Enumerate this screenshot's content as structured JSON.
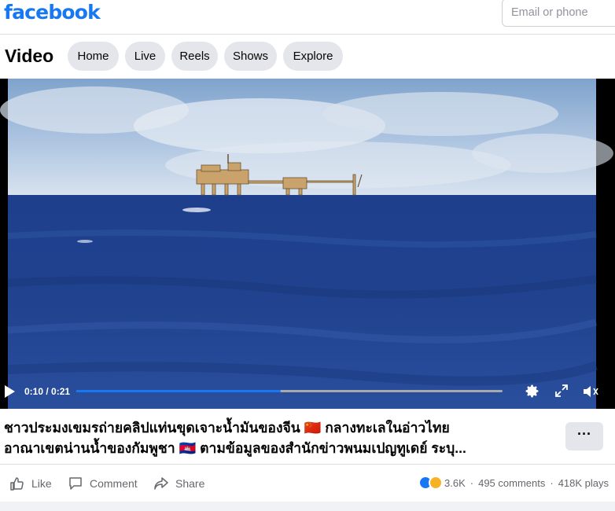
{
  "header": {
    "logo": "facebook",
    "email_placeholder": "Email or phone"
  },
  "nav": {
    "title": "Video",
    "pills": [
      "Home",
      "Live",
      "Reels",
      "Shows",
      "Explore"
    ]
  },
  "player": {
    "time": "0:10 / 0:21",
    "progress": 0.48
  },
  "post": {
    "caption_line1": "ชาวประมงเขมรถ่ายคลิปแท่นขุดเจาะน้ำมันของจีน 🇨🇳 กลางทะเลในอ่าวไทย",
    "caption_line2": "อาณาเขตน่านน้ำของกัมพูชา 🇰🇭 ตามข้อมูลของสำนักข่าวพนมเปญทูเดย์ ระบุ...",
    "more_label": "···",
    "actions": {
      "like": "Like",
      "comment": "Comment",
      "share": "Share"
    },
    "reactions_count": "3.6K",
    "comments": "495 comments",
    "plays": "418K plays"
  },
  "colors": {
    "brand": "#1877f2",
    "pill_bg": "#e4e6eb"
  }
}
